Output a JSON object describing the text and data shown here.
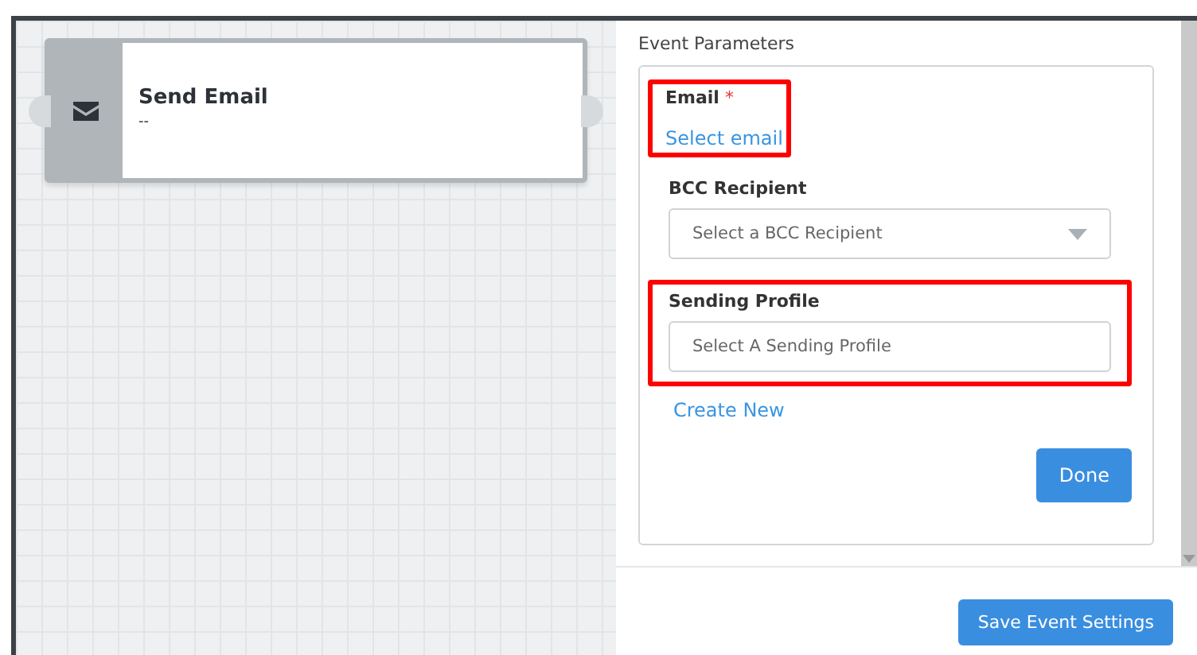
{
  "node": {
    "title": "Send Email",
    "subtitle": "--"
  },
  "panel": {
    "heading": "Event Parameters",
    "fields": [
      {
        "kind": "link",
        "label": "Email",
        "required_mark": "*",
        "value": "Select email",
        "highlighted": true
      },
      {
        "kind": "dropdown",
        "label": "BCC Recipient",
        "placeholder": "Select a BCC Recipient",
        "highlighted": false
      },
      {
        "kind": "input",
        "label": "Sending Profile",
        "placeholder": "Select A Sending Profile",
        "highlighted": true
      }
    ],
    "create_link": "Create New",
    "done_button": "Done"
  },
  "footer": {
    "save_button": "Save Event Settings"
  }
}
